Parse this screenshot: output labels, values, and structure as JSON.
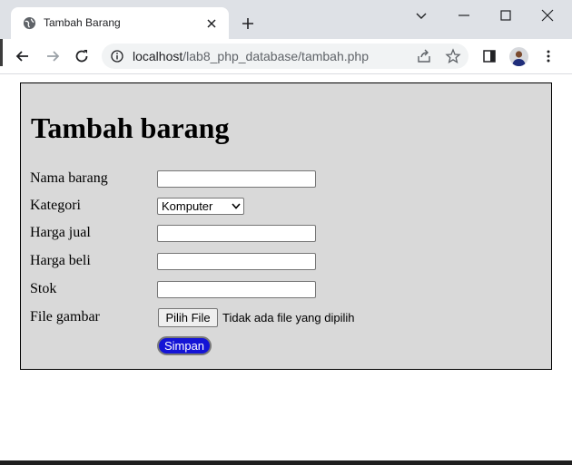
{
  "browser": {
    "tab_title": "Tambah Barang",
    "url_host": "localhost",
    "url_path": "/lab8_php_database/tambah.php",
    "icons": {
      "favicon": "globe-icon",
      "tab_close": "close-icon",
      "new_tab": "plus-icon",
      "tab_search": "chevron-down-icon",
      "minimize": "minimize-icon",
      "maximize": "maximize-icon",
      "close_window": "close-icon",
      "back": "arrow-left-icon",
      "forward": "arrow-right-icon",
      "reload": "reload-icon",
      "site_info": "info-icon",
      "share": "share-icon",
      "bookmark": "star-icon",
      "side_panel": "side-panel-icon",
      "profile": "avatar",
      "menu": "kebab-menu-icon"
    }
  },
  "page": {
    "title": "Tambah barang",
    "form": {
      "nama_barang": {
        "label": "Nama barang",
        "value": ""
      },
      "kategori": {
        "label": "Kategori",
        "selected": "Komputer"
      },
      "harga_jual": {
        "label": "Harga jual",
        "value": ""
      },
      "harga_beli": {
        "label": "Harga beli",
        "value": ""
      },
      "stok": {
        "label": "Stok",
        "value": ""
      },
      "file_gambar": {
        "label": "File gambar",
        "button_label": "Pilih File",
        "status": "Tidak ada file yang dipilih"
      },
      "submit_label": "Simpan"
    }
  },
  "colors": {
    "form_background": "#d9d9d9",
    "submit_background": "#1414d6",
    "chrome_background": "#dee1e6"
  }
}
